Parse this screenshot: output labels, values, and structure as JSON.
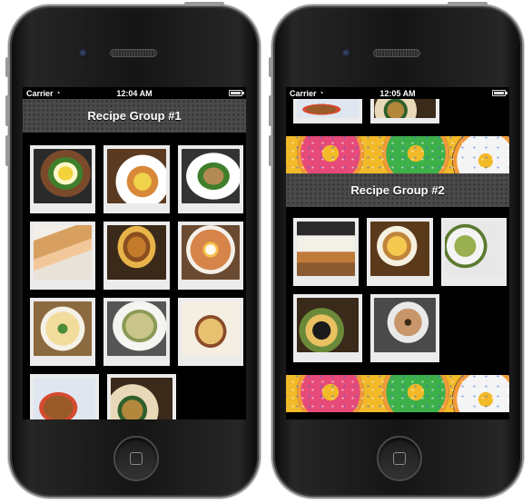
{
  "left_phone": {
    "status": {
      "carrier": "Carrier",
      "time": "12:04 AM"
    },
    "header": {
      "title": "Recipe Group #1"
    },
    "photos": [
      [
        "eggs-dish",
        "breakfast-plate",
        "sandwich-plate"
      ],
      [
        "spring-rolls",
        "burger",
        "noodles-with-egg"
      ],
      [
        "ramen-bowl",
        "rice-dish",
        "pasta-with-meat"
      ],
      [
        "fried-chicken",
        "soup-bowls"
      ]
    ]
  },
  "right_phone": {
    "status": {
      "carrier": "Carrier",
      "time": "12:05 AM"
    },
    "header": {
      "title": "Recipe Group #2"
    },
    "photos": [
      [
        "birthday-cake",
        "creme-brulee",
        "green-tea"
      ],
      [
        "latte-dish",
        "donut-plate"
      ]
    ]
  },
  "icons": {
    "wifi": "wifi-icon",
    "battery": "battery-icon",
    "home": "home-button"
  },
  "colors": {
    "banner": "#f2b928",
    "header": "#4a4a4a",
    "polaroid": "#ebebeb"
  }
}
